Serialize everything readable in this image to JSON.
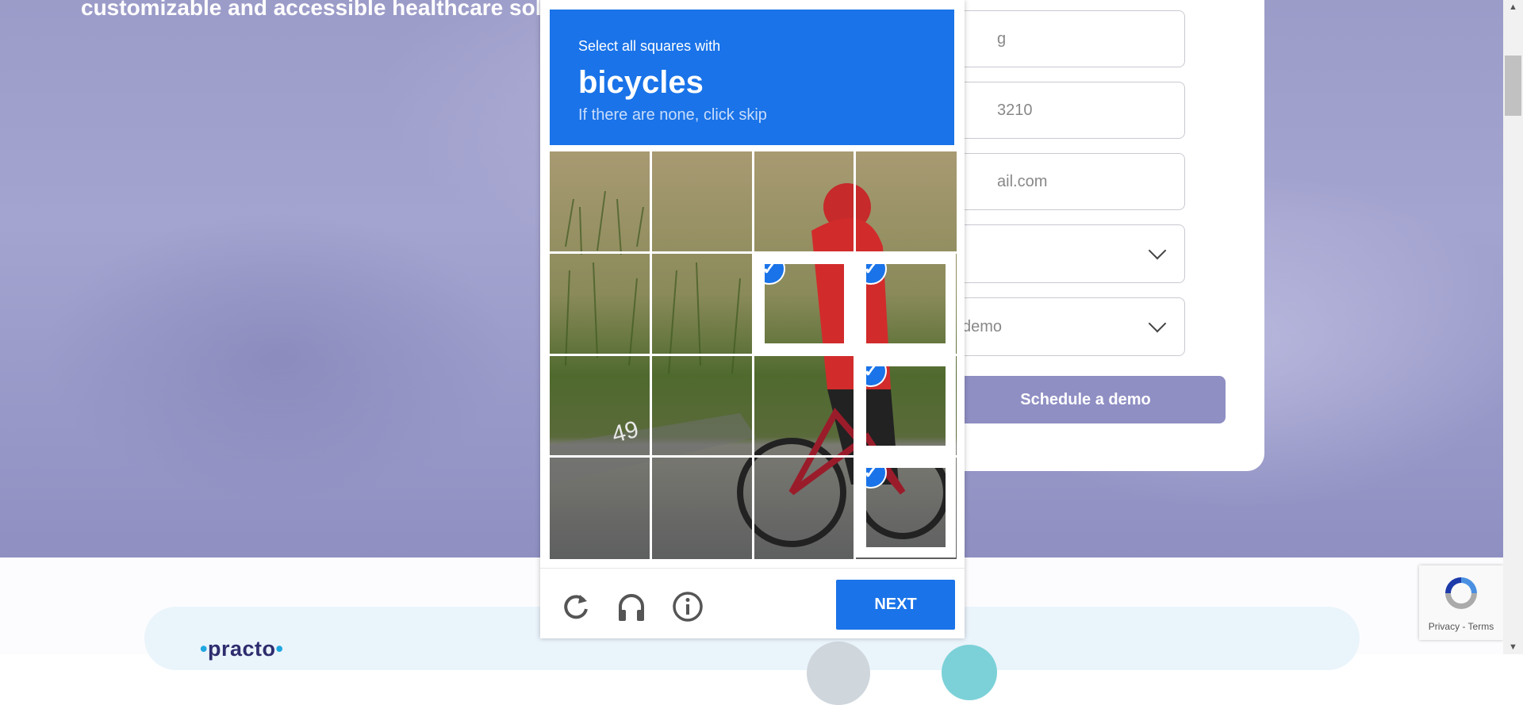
{
  "hero": {
    "heading": "customizable and accessible healthcare solu"
  },
  "form": {
    "fields": [
      {
        "value_fragment": "g"
      },
      {
        "value_fragment": "3210"
      },
      {
        "value_fragment": "ail.com"
      },
      {
        "value_fragment": ""
      },
      {
        "value_fragment": "demo"
      }
    ],
    "submit_label": "Schedule a demo"
  },
  "captcha": {
    "prompt_small": "Select all squares with",
    "prompt_target": "bicycles",
    "prompt_hint": "If there are none, click skip",
    "selected_tiles": [
      6,
      7,
      11,
      15
    ],
    "next_label": "NEXT",
    "check_glyph": "✓",
    "icons": [
      "reload-icon",
      "audio-headphones-icon",
      "info-icon"
    ]
  },
  "badge": {
    "text": "Privacy - Terms"
  },
  "logo": {
    "text": "practo"
  },
  "colors": {
    "captcha_blue": "#1a73e8",
    "button_purple": "#8f8fc4",
    "hero_purple": "#9c9cc9"
  }
}
